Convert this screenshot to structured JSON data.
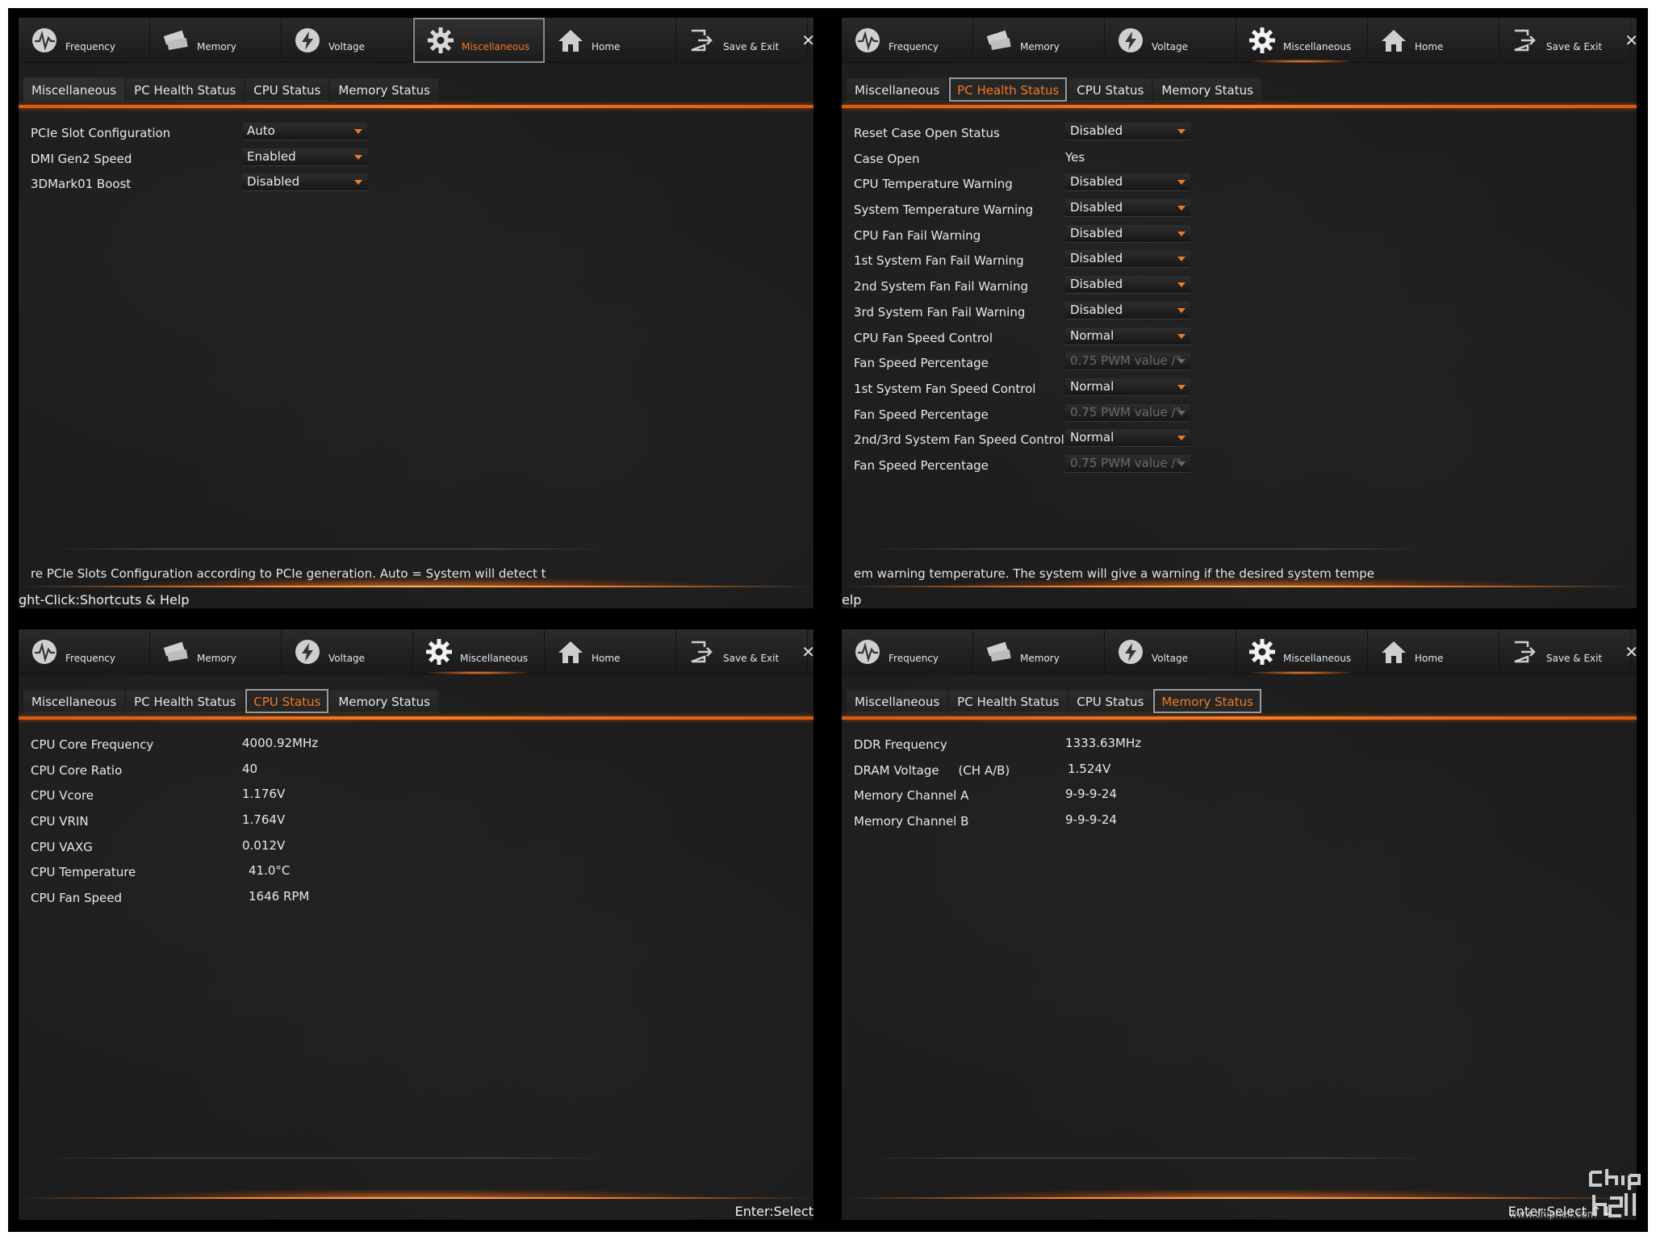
{
  "nav": {
    "items": [
      "Frequency",
      "Memory",
      "Voltage",
      "Miscellaneous",
      "Home",
      "Save & Exit"
    ],
    "close_icon": "close-icon"
  },
  "subtabs": [
    "Miscellaneous",
    "PC Health Status",
    "CPU Status",
    "Memory Status"
  ],
  "colors": {
    "accent": "#f07a22",
    "panel_bg": "#1d1d1d",
    "text": "#e8e8e8"
  },
  "panel1": {
    "rows": [
      {
        "label": "PCIe Slot Configuration",
        "value": "Auto"
      },
      {
        "label": "DMI Gen2 Speed",
        "value": "Enabled"
      },
      {
        "label": "3DMark01 Boost",
        "value": "Disabled"
      }
    ],
    "help": "re PCIe Slots Configuration according to PCIe generation. Auto = System will detect t",
    "bottom": "ght-Click:Shortcuts & Help"
  },
  "panel2": {
    "rows": [
      {
        "label": "Reset Case Open Status",
        "value": "Disabled"
      },
      {
        "label": "Case Open",
        "value": "Yes"
      },
      {
        "label": "CPU Temperature Warning",
        "value": "Disabled"
      },
      {
        "label": "System Temperature Warning",
        "value": "Disabled"
      },
      {
        "label": "CPU Fan Fail Warning",
        "value": "Disabled"
      },
      {
        "label": "1st System Fan Fail Warning",
        "value": "Disabled"
      },
      {
        "label": "2nd System Fan Fail Warning",
        "value": "Disabled"
      },
      {
        "label": "3rd System Fan Fail Warning",
        "value": "Disabled"
      },
      {
        "label": "CPU Fan Speed Control",
        "value": "Normal"
      },
      {
        "label": "Fan Speed Percentage",
        "value": "0.75 PWM value /°"
      },
      {
        "label": "1st System Fan Speed Control",
        "value": "Normal"
      },
      {
        "label": "Fan Speed Percentage",
        "value": "0.75 PWM value /°"
      },
      {
        "label": "2nd/3rd System Fan Speed Control",
        "value": "Normal"
      },
      {
        "label": "Fan Speed Percentage",
        "value": "0.75 PWM value /°"
      }
    ],
    "help": "em warning temperature. The system will  give a warning if the desired system tempe",
    "bottom": "elp"
  },
  "panel3": {
    "rows": [
      {
        "label": "CPU Core Frequency",
        "value": "4000.92MHz"
      },
      {
        "label": "CPU Core Ratio",
        "value": "40"
      },
      {
        "label": "CPU Vcore",
        "value": "1.176V"
      },
      {
        "label": "CPU VRIN",
        "value": "1.764V"
      },
      {
        "label": "CPU VAXG",
        "value": "0.012V"
      },
      {
        "label": "CPU Temperature",
        "value": "41.0°C"
      },
      {
        "label": "CPU Fan Speed",
        "value": "1646 RPM"
      }
    ],
    "bottom_right": "Enter:Select"
  },
  "panel4": {
    "rows": [
      {
        "label": "DDR Frequency",
        "value": "1333.63MHz"
      },
      {
        "label": "DRAM Voltage     (CH A/B)",
        "value": "1.524V"
      },
      {
        "label": "Memory Channel A",
        "value": "9-9-9-24"
      },
      {
        "label": "Memory Channel B",
        "value": "9-9-9-24"
      }
    ],
    "bottom_right": "Enter:Select  ↑↓",
    "watermark_url": "www.chiphell.com"
  }
}
